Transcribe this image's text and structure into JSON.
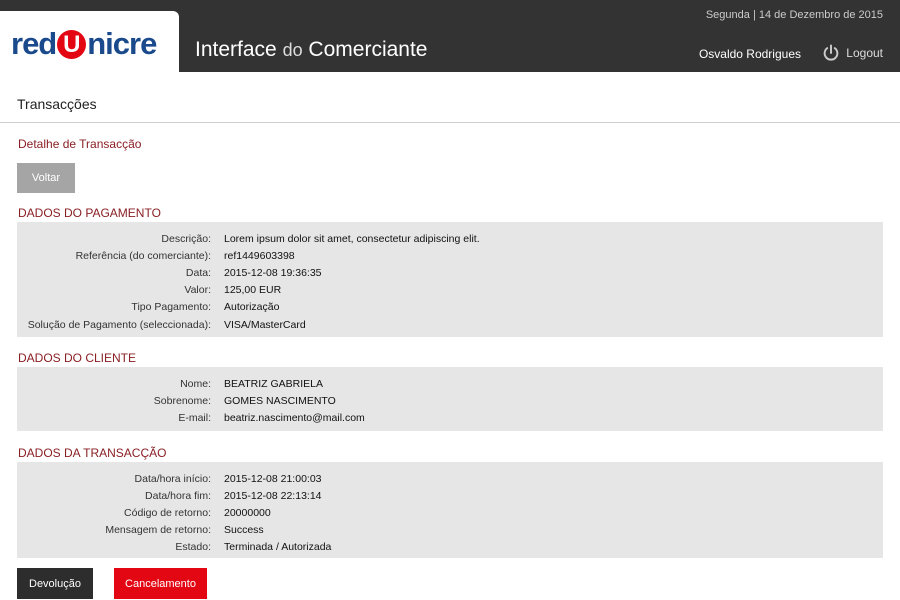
{
  "header": {
    "logo": {
      "part1": "red",
      "part2": "U",
      "part3": "nicre"
    },
    "title_a": "Interface ",
    "title_b": "do",
    "title_c": " Comerciante",
    "date": "Segunda | 14 de Dezembro de 2015",
    "user": "Osvaldo Rodrigues",
    "logout_label": "Logout",
    "logout_icon": "power-icon"
  },
  "page": {
    "title": "Transacções",
    "subtitle": "Detalhe de Transacção",
    "back_label": "Voltar"
  },
  "payment": {
    "title": "DADOS DO PAGAMENTO",
    "rows": [
      {
        "k": "Descrição:",
        "v": "Lorem ipsum dolor sit amet, consectetur adipiscing elit."
      },
      {
        "k": "Referência (do comerciante):",
        "v": "ref1449603398"
      },
      {
        "k": "Data:",
        "v": "2015-12-08 19:36:35"
      },
      {
        "k": "Valor:",
        "v": "125,00 EUR"
      },
      {
        "k": "Tipo Pagamento:",
        "v": "Autorização"
      },
      {
        "k": "Solução de Pagamento (seleccionada):",
        "v": "VISA/MasterCard"
      }
    ]
  },
  "client": {
    "title": "DADOS DO CLIENTE",
    "rows": [
      {
        "k": "Nome:",
        "v": "BEATRIZ GABRIELA"
      },
      {
        "k": "Sobrenome:",
        "v": "GOMES NASCIMENTO"
      },
      {
        "k": "E-mail:",
        "v": "beatriz.nascimento@mail.com"
      }
    ]
  },
  "transaction": {
    "title": "DADOS DA TRANSACÇÃO",
    "rows": [
      {
        "k": "Data/hora início:",
        "v": "2015-12-08 21:00:03"
      },
      {
        "k": "Data/hora fim:",
        "v": "2015-12-08 22:13:14"
      },
      {
        "k": "Código de retorno:",
        "v": "20000000"
      },
      {
        "k": "Mensagem de retorno:",
        "v": "Success"
      },
      {
        "k": "Estado:",
        "v": "Terminada / Autorizada"
      }
    ]
  },
  "actions": {
    "refund_label": "Devolução",
    "cancel_label": "Cancelamento"
  },
  "colors": {
    "header_bg": "#333333",
    "accent_red": "#e30613",
    "brand_blue": "#1a4a8c",
    "section_title": "#8a1f24",
    "panel_bg": "#e6e6e6"
  }
}
